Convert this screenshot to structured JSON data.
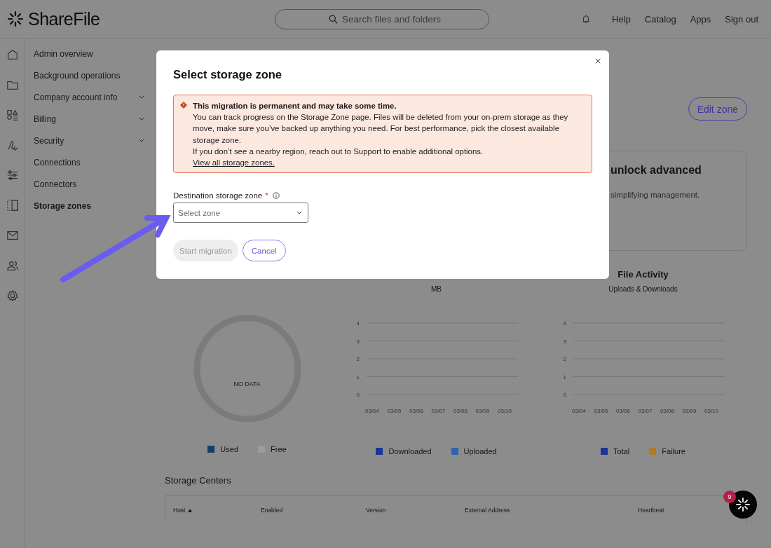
{
  "header": {
    "logo": "ShareFile",
    "search": {
      "placeholder": "Search files and folders"
    },
    "links": [
      "Help",
      "Catalog",
      "Apps",
      "Sign out"
    ]
  },
  "sidebar": {
    "items": [
      {
        "label": "Admin overview",
        "expandable": false,
        "selected": false
      },
      {
        "label": "Background operations",
        "expandable": false,
        "selected": false
      },
      {
        "label": "Company account info",
        "expandable": true,
        "selected": false
      },
      {
        "label": "Billing",
        "expandable": true,
        "selected": false
      },
      {
        "label": "Security",
        "expandable": true,
        "selected": false
      },
      {
        "label": "Connections",
        "expandable": false,
        "selected": false
      },
      {
        "label": "Connectors",
        "expandable": false,
        "selected": false
      },
      {
        "label": "Storage zones",
        "expandable": false,
        "selected": true
      }
    ]
  },
  "page": {
    "edit_button": "Edit zone",
    "promo": {
      "title": "unlock advanced",
      "text": "simplifying management."
    },
    "usage": {
      "center_label": "NO DATA",
      "legend": [
        {
          "label": "Used",
          "color": "#173b6b"
        },
        {
          "label": "Free",
          "color": "#9c9c9c"
        }
      ]
    },
    "transfer": {
      "chart_data": {
        "type": "line",
        "title": "MB",
        "grid": true,
        "categories": [
          "03/04",
          "03/05",
          "03/06",
          "03/07",
          "03/08",
          "03/09",
          "03/10"
        ],
        "ylim": [
          0,
          4
        ],
        "yticks": [
          0,
          1,
          2,
          3,
          4
        ],
        "series": [
          {
            "name": "Downloaded",
            "color": "#1a3596",
            "values": [
              null,
              null,
              null,
              null,
              null,
              null,
              null
            ]
          },
          {
            "name": "Uploaded",
            "color": "#2f63b0",
            "values": [
              null,
              null,
              null,
              null,
              null,
              null,
              null
            ]
          }
        ]
      }
    },
    "activity": {
      "heading": "File Activity",
      "chart_data": {
        "type": "line",
        "title": "Uploads & Downloads",
        "grid": true,
        "categories": [
          "03/04",
          "03/05",
          "03/06",
          "03/07",
          "03/08",
          "03/09",
          "03/10"
        ],
        "ylim": [
          0,
          4
        ],
        "yticks": [
          0,
          1,
          2,
          3,
          4
        ],
        "series": [
          {
            "name": "Total",
            "color": "#1a3596",
            "values": [
              null,
              null,
              null,
              null,
              null,
              null,
              null
            ]
          },
          {
            "name": "Failure",
            "color": "#b07a28",
            "values": [
              null,
              null,
              null,
              null,
              null,
              null,
              null
            ]
          }
        ]
      }
    },
    "storage_centers": {
      "title": "Storage Centers",
      "columns": [
        {
          "label": "Host",
          "sorted": true
        },
        {
          "label": "Enabled",
          "sorted": false
        },
        {
          "label": "Version",
          "sorted": false
        },
        {
          "label": "External Address",
          "sorted": false
        },
        {
          "label": "Heartbeat",
          "sorted": false
        }
      ]
    }
  },
  "modal": {
    "title": "Select storage zone",
    "alert": {
      "heading": "This migration is permanent and may take some time.",
      "lines": [
        "You can track progress on the Storage Zone page. Files will be deleted from your on-prem storage as they move, make sure you’ve backed up anything you need. For best performance, pick the closest available storage zone.",
        "If you don’t see a nearby region, reach out to Support to enable additional options."
      ],
      "link": "View all storage zones."
    },
    "field": {
      "label": "Destination storage zone",
      "required_mark": "*",
      "placeholder": "Select zone"
    },
    "buttons": [
      {
        "label": "Start migration",
        "disabled": true
      },
      {
        "label": "Cancel",
        "disabled": false
      }
    ]
  },
  "chat": {
    "badge": "9"
  }
}
